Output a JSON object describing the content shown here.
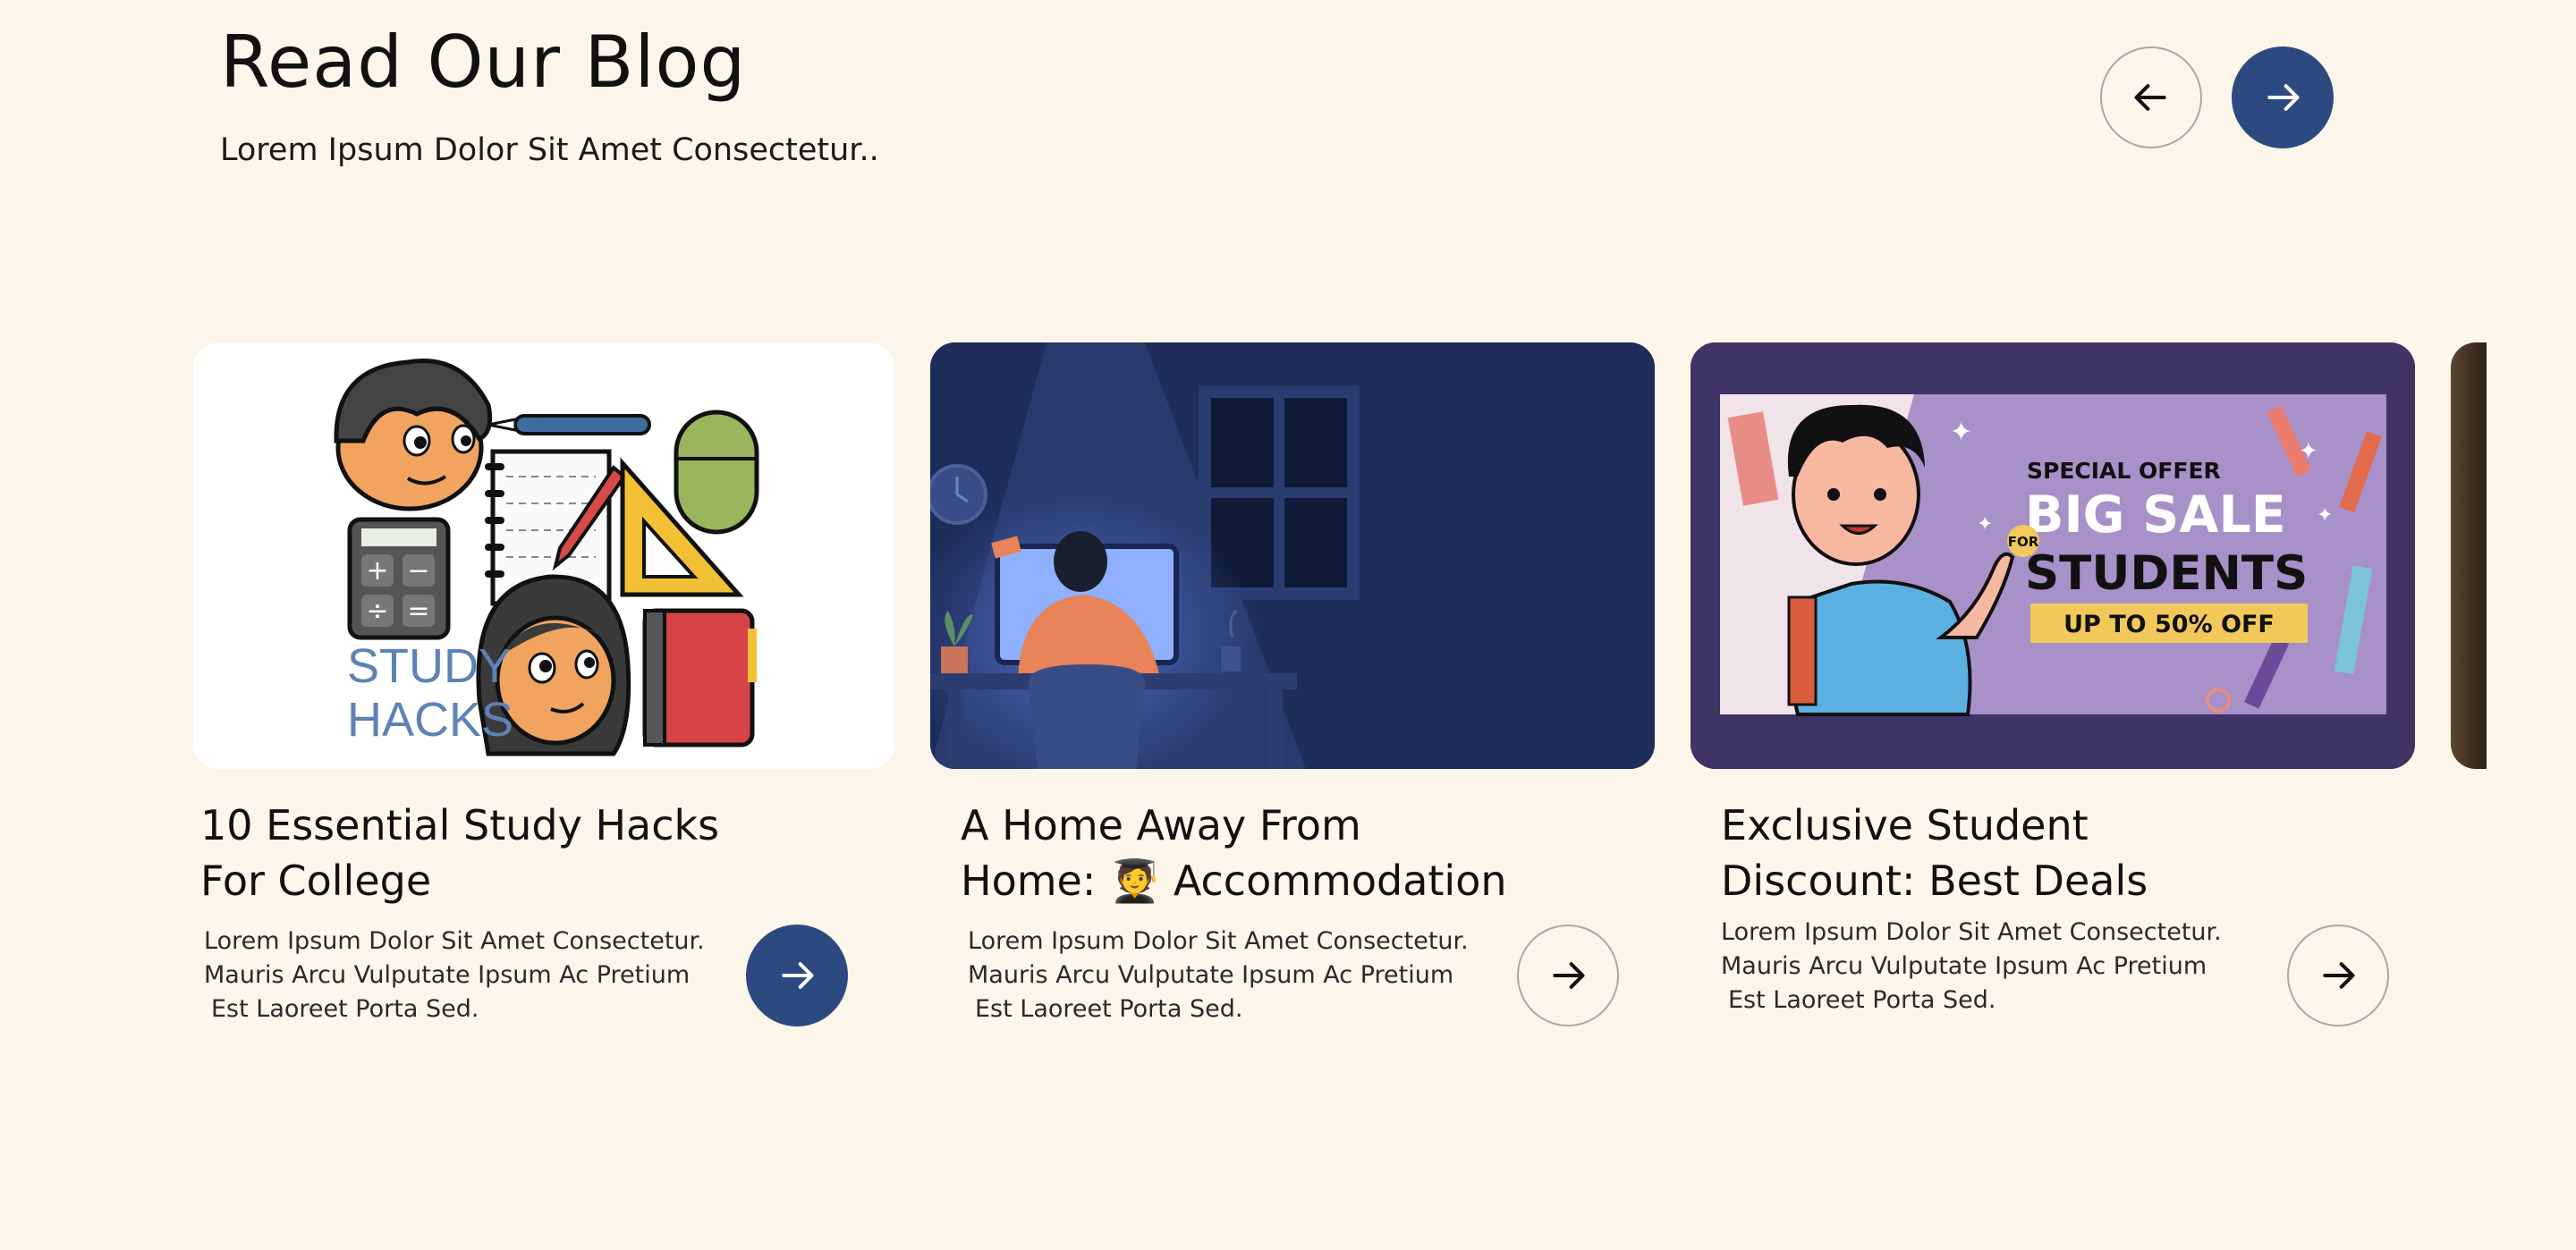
{
  "header": {
    "title": "Read Our Blog",
    "subtitle": "Lorem Ipsum Dolor Sit Amet Consectetur.."
  },
  "nav": {
    "prev_icon": "arrow-left-icon",
    "next_icon": "arrow-right-icon"
  },
  "colors": {
    "background": "#fcf5e9",
    "accent": "#2c4a80"
  },
  "cards": [
    {
      "title_line1": "10 Essential Study Hacks",
      "title_line2": "For College",
      "desc_line1": "Lorem Ipsum Dolor Sit Amet Consectetur.",
      "desc_line2": "Mauris Arcu Vulputate Ipsum Ac Pretium",
      "desc_line3": "Est Laoreet Porta Sed.",
      "image_text_line1": "STUDY",
      "image_text_line2": "HACKS",
      "button_icon": "arrow-right-icon"
    },
    {
      "title_line1": "A Home Away From",
      "title_line2": "Home: 🧑‍🎓 Accommodation",
      "desc_line1": "Lorem Ipsum Dolor Sit Amet Consectetur.",
      "desc_line2": "Mauris Arcu Vulputate Ipsum Ac Pretium",
      "desc_line3": "Est Laoreet Porta Sed.",
      "button_icon": "arrow-right-icon"
    },
    {
      "title_line1": "Exclusive Student",
      "title_line2": "Discount: Best Deals",
      "desc_line1": "Lorem Ipsum Dolor Sit Amet Consectetur.",
      "desc_line2": "Mauris Arcu Vulputate Ipsum Ac Pretium",
      "desc_line3": "Est Laoreet Porta Sed.",
      "image_special": "SPECIAL OFFER",
      "image_big": "BIG SALE",
      "image_for": "FOR",
      "image_students": "STUDENTS",
      "image_discount": "UP TO 50% OFF",
      "button_icon": "arrow-right-icon"
    }
  ]
}
